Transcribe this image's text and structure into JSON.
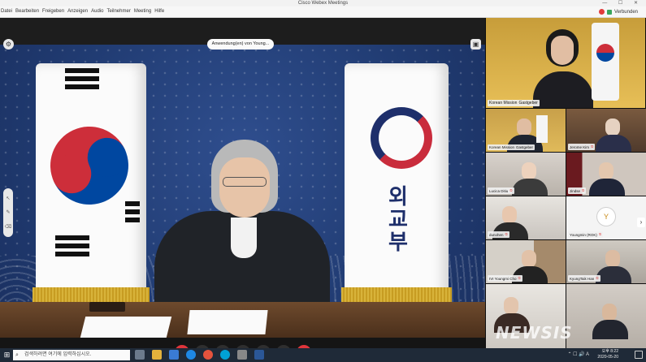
{
  "window": {
    "title": "Cisco Webex Meetings",
    "controls": "—  ☐  ✕"
  },
  "menubar": {
    "items": [
      "Datei",
      "Bearbeiten",
      "Freigeben",
      "Anzeigen",
      "Audio",
      "Teilnehmer",
      "Meeting",
      "Hilfe"
    ],
    "connection_status": "Verbunden"
  },
  "stage": {
    "sharing_label": "Anwendung(en) von Young...",
    "flag_text": "외교부"
  },
  "participants": {
    "active": {
      "name": "Korean Mission",
      "status": "Gastgeber"
    },
    "tiles": [
      {
        "name": "Korean Mission",
        "status": "Gastgeber"
      },
      {
        "name": "Jerome Kim"
      },
      {
        "name": "Lucica Ditiu"
      },
      {
        "name": "Jindse"
      },
      {
        "name": "dunohen"
      },
      {
        "name": "Youngmin (ROK)",
        "initial": "Y"
      },
      {
        "name": "IVI Youngmi Cho"
      },
      {
        "name": "KyungTaik Han"
      }
    ]
  },
  "watermark": "NEWSIS",
  "taskbar": {
    "search_placeholder": "검색하려면 여기에 입력하십시오.",
    "time": "오후 8:22",
    "date": "2020-05-20"
  },
  "colors": {
    "end_call": "#e0353b",
    "backdrop": "#213c73",
    "speaker_bg": "#e7bf57"
  }
}
